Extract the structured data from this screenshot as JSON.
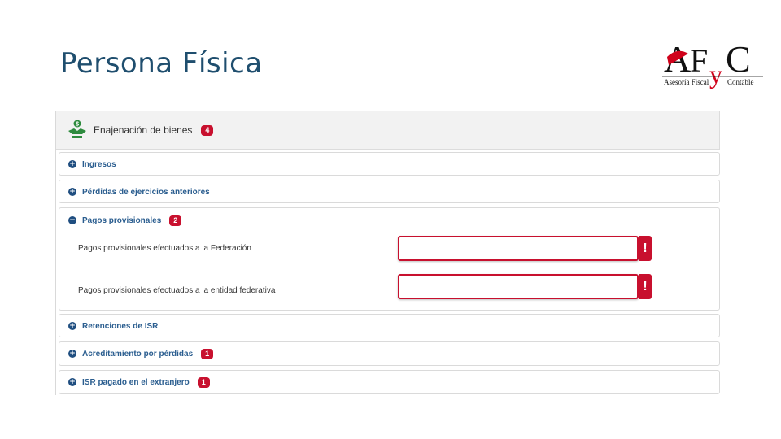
{
  "slide": {
    "title": "Persona Física"
  },
  "logo": {
    "letters": "AFyC",
    "left_text": "Asesoría Fiscal",
    "right_text": "Contable"
  },
  "panel": {
    "title": "Enajenación de bienes",
    "badge": "4",
    "icon": "money-handshake-icon"
  },
  "sections": [
    {
      "label": "Ingresos",
      "state": "collapsed",
      "icon": "plus-circle-icon"
    },
    {
      "label": "Pérdidas de ejercicios anteriores",
      "state": "collapsed",
      "icon": "plus-circle-icon"
    },
    {
      "label": "Pagos provisionales",
      "state": "expanded",
      "badge": "2",
      "icon": "minus-circle-icon",
      "fields": [
        {
          "label": "Pagos provisionales efectuados a la Federación",
          "value": ""
        },
        {
          "label": "Pagos provisionales efectuados a la entidad federativa",
          "value": ""
        }
      ]
    },
    {
      "label": "Retenciones de ISR",
      "state": "collapsed",
      "icon": "plus-circle-icon"
    },
    {
      "label": "Acreditamiento por pérdidas",
      "state": "collapsed",
      "badge": "1",
      "icon": "plus-circle-icon"
    },
    {
      "label": "ISR pagado en el extranjero",
      "state": "collapsed",
      "badge": "1",
      "icon": "plus-circle-icon"
    }
  ],
  "colors": {
    "title": "#1f4e6e",
    "accent": "#c8102e",
    "link": "#2a5d8f"
  },
  "alert_glyph": "!",
  "toggle_glyphs": {
    "collapsed": "+",
    "expanded": "−"
  }
}
